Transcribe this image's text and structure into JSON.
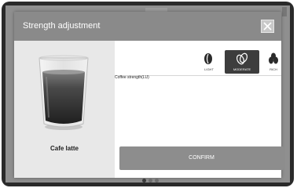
{
  "dialog": {
    "title": "Strength adjustment",
    "close_icon": "close-icon"
  },
  "product": {
    "name": "Cafe latte",
    "image_icon": "latte-glass-icon"
  },
  "strength": {
    "label": "Coffee strength(LU)",
    "options": [
      {
        "label": "LIGHT",
        "icon": "single-bean-icon",
        "selected": false
      },
      {
        "label": "MODERATE",
        "icon": "double-bean-icon",
        "selected": true
      },
      {
        "label": "RICH",
        "icon": "triple-bean-icon",
        "selected": false
      }
    ]
  },
  "actions": {
    "confirm_label": "CONFIRM"
  },
  "pager": {
    "pages": 3,
    "active_index": 0
  },
  "colors": {
    "header": "#8a8a8a",
    "selected_option": "#3d3d3d",
    "confirm_button": "#8d8d8d"
  }
}
